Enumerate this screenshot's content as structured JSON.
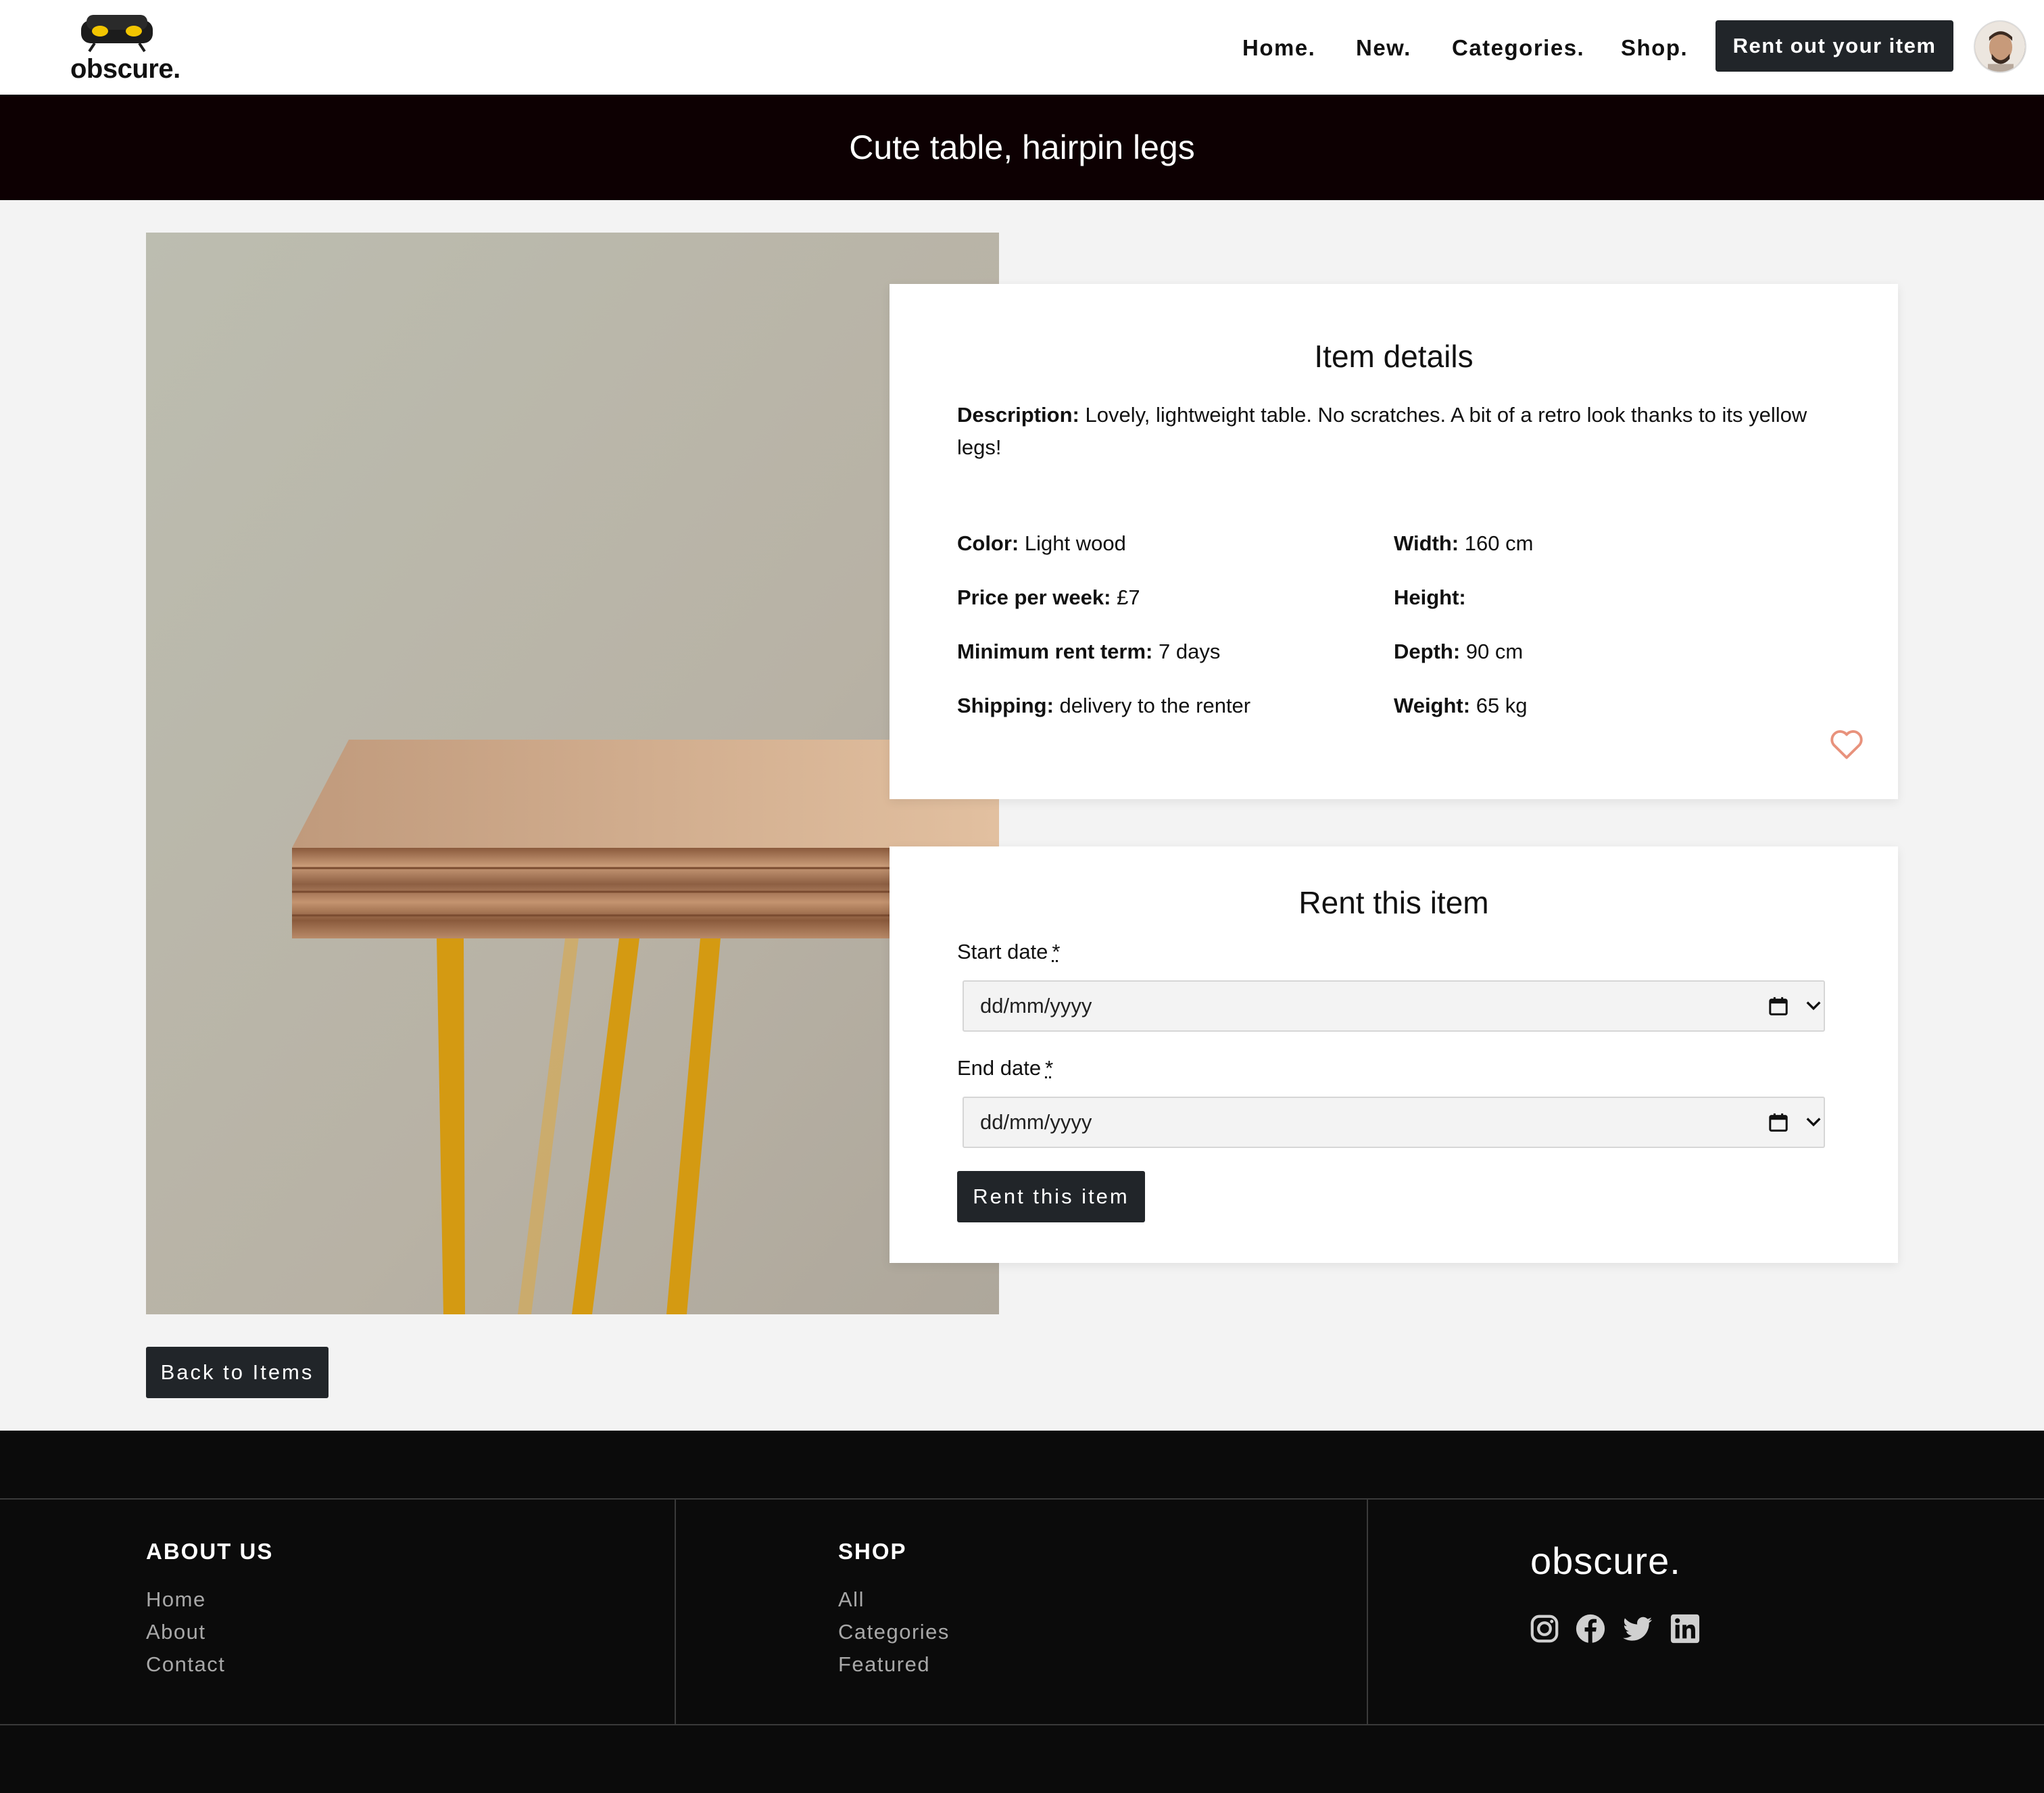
{
  "header": {
    "logo_text": "obscure.",
    "nav": [
      "Home.",
      "New.",
      "Categories.",
      "Shop."
    ],
    "rent_out_label": "Rent out your item"
  },
  "page_title": "Cute table, hairpin legs",
  "details": {
    "title": "Item details",
    "description_label": "Description:",
    "description": "Lovely, lightweight table. No scratches. A bit of a retro look thanks to its yellow legs!",
    "color_label": "Color:",
    "color": "Light wood",
    "price_label": "Price per week:",
    "price": "£7",
    "min_term_label": "Minimum rent term:",
    "min_term": "7 days",
    "shipping_label": "Shipping:",
    "shipping": "delivery to the renter",
    "width_label": "Width:",
    "width": "160 cm",
    "height_label": "Height:",
    "height": "",
    "depth_label": "Depth:",
    "depth": "90 cm",
    "weight_label": "Weight:",
    "weight": "65 kg"
  },
  "rent": {
    "title": "Rent this item",
    "start_label": "Start date",
    "end_label": "End date",
    "required_mark": "*",
    "start_value": "dd/mm/yyyy",
    "end_value": "dd/mm/yyyy",
    "button_label": "Rent this item"
  },
  "back_label": "Back to Items",
  "footer": {
    "about_heading": "ABOUT US",
    "about_links": [
      "Home",
      "About",
      "Contact"
    ],
    "shop_heading": "SHOP",
    "shop_links": [
      "All",
      "Categories",
      "Featured"
    ],
    "brand": "obscure."
  },
  "icons": [
    "sofa-logo-icon",
    "heart-icon",
    "calendar-icon",
    "chevron-down-icon",
    "instagram-icon",
    "facebook-icon",
    "twitter-icon",
    "linkedin-icon"
  ],
  "colors": {
    "dark": "#212529",
    "banner": "#0d0002",
    "heart": "#e8927c",
    "footer": "#0b0b0b"
  }
}
